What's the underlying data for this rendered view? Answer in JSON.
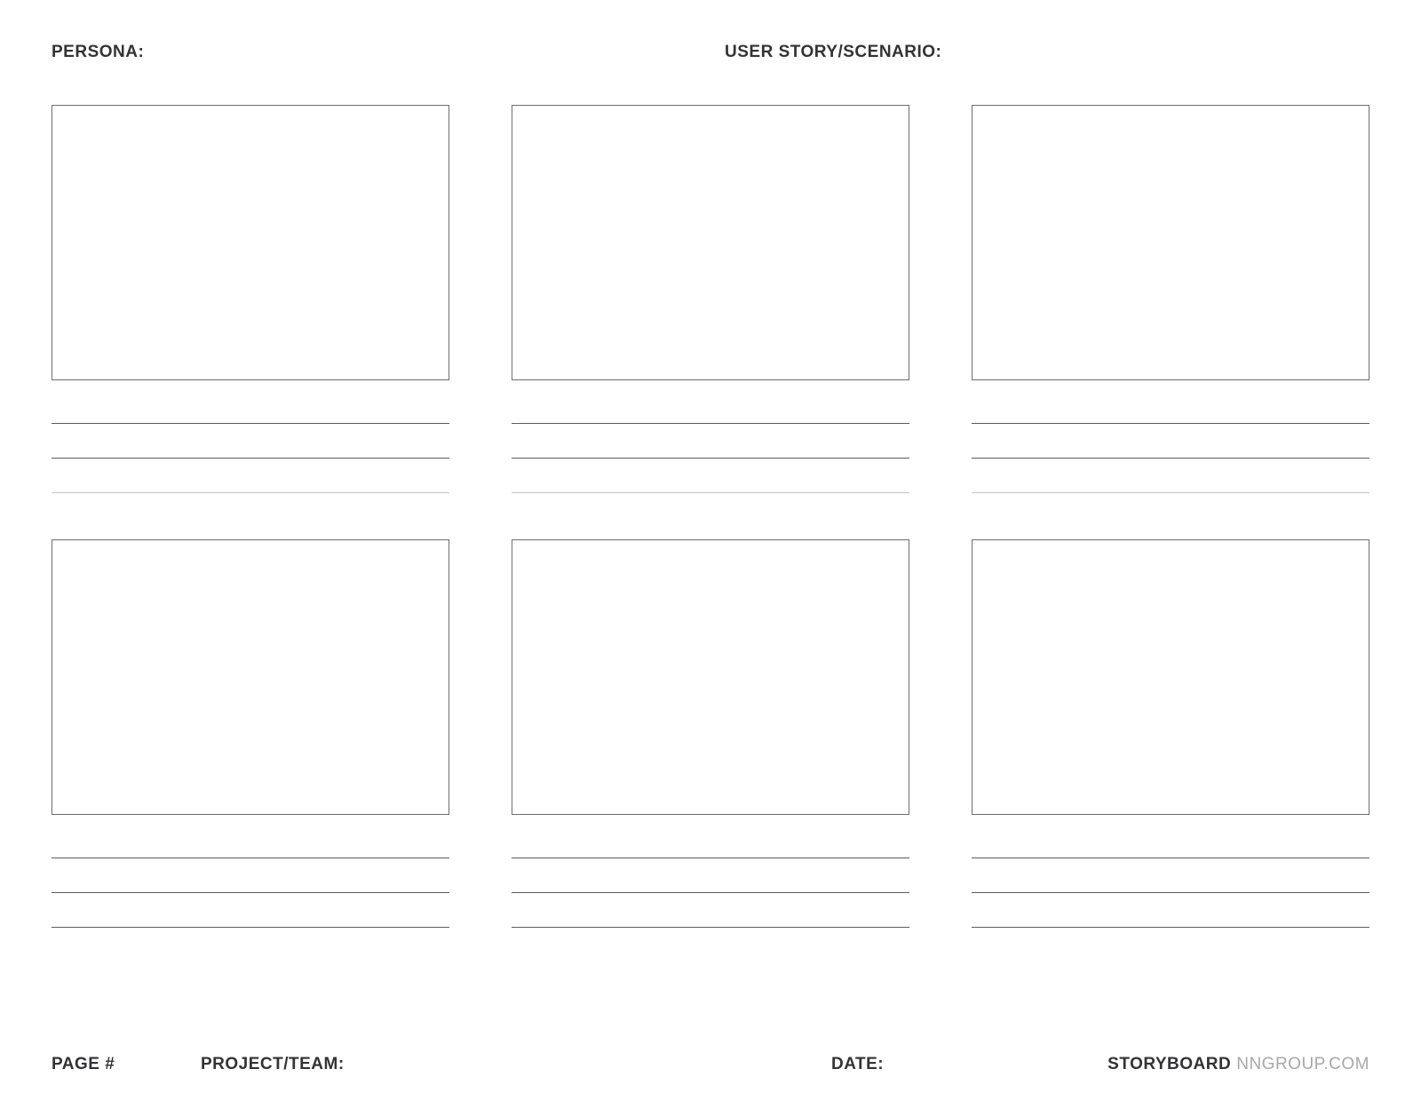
{
  "header": {
    "persona_label": "PERSONA:",
    "scenario_label": "USER STORY/SCENARIO:"
  },
  "footer": {
    "page_label": "PAGE #",
    "project_label": "PROJECT/TEAM:",
    "date_label": "DATE:",
    "brand_bold": "STORYBOARD",
    "brand_light": "NNGROUP.COM"
  }
}
